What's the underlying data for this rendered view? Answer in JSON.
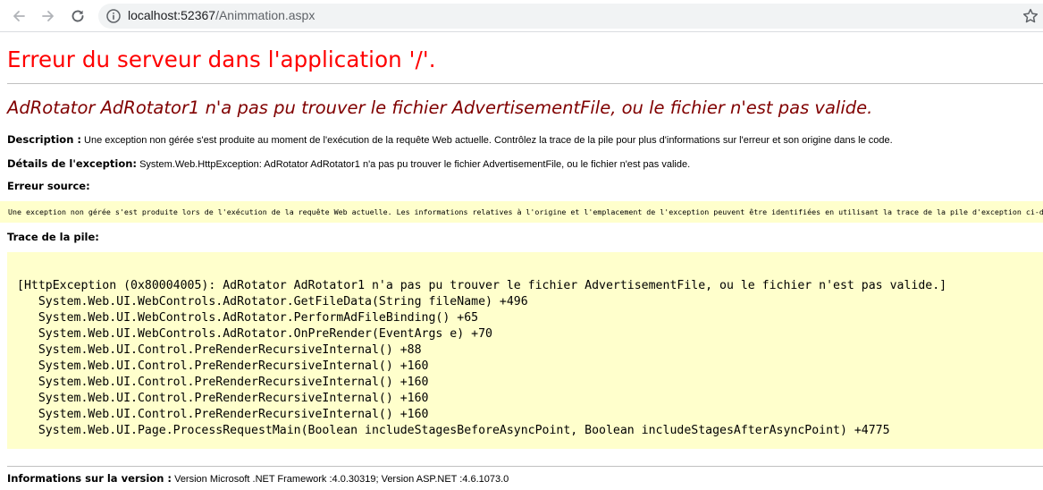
{
  "browser": {
    "url_host": "localhost:52367",
    "url_path": "/Animmation.aspx"
  },
  "page": {
    "title": "Erreur du serveur dans l'application '/'.",
    "error_heading": "AdRotator AdRotator1 n'a pas pu trouver le fichier AdvertisementFile, ou le fichier n'est pas valide.",
    "description_label": "Description :",
    "description_text": " Une exception non gérée s'est produite au moment de l'exécution de la requête Web actuelle. Contrôlez la trace de la pile pour plus d'informations sur l'erreur et son origine dans le code.",
    "exception_label": "Détails de l'exception:",
    "exception_text": " System.Web.HttpException: AdRotator AdRotator1 n'a pas pu trouver le fichier AdvertisementFile, ou le fichier n'est pas valide.",
    "source_label": "Erreur source:",
    "source_text": "Une exception non gérée s'est produite lors de l'exécution de la requête Web actuelle. Les informations relatives à l'origine et l'emplacement de l'exception peuvent être identifiées en utilisant la trace de la pile d'exception ci-dessous.",
    "stack_label": "Trace de la pile:",
    "stack_lines": [
      "[HttpException (0x80004005): AdRotator AdRotator1 n'a pas pu trouver le fichier AdvertisementFile, ou le fichier n'est pas valide.]",
      "   System.Web.UI.WebControls.AdRotator.GetFileData(String fileName) +496",
      "   System.Web.UI.WebControls.AdRotator.PerformAdFileBinding() +65",
      "   System.Web.UI.WebControls.AdRotator.OnPreRender(EventArgs e) +70",
      "   System.Web.UI.Control.PreRenderRecursiveInternal() +88",
      "   System.Web.UI.Control.PreRenderRecursiveInternal() +160",
      "   System.Web.UI.Control.PreRenderRecursiveInternal() +160",
      "   System.Web.UI.Control.PreRenderRecursiveInternal() +160",
      "   System.Web.UI.Control.PreRenderRecursiveInternal() +160",
      "   System.Web.UI.Page.ProcessRequestMain(Boolean includeStagesBeforeAsyncPoint, Boolean includeStagesAfterAsyncPoint) +4775"
    ],
    "version_label": "Informations sur la version :",
    "version_text": " Version Microsoft .NET Framework :4.0.30319; Version ASP.NET :4.6.1073.0"
  },
  "icons": {
    "back": "arrow-left-icon",
    "forward": "arrow-right-icon",
    "reload": "reload-icon",
    "info": "info-icon",
    "bookmark": "star-icon"
  },
  "colors": {
    "title": "#ff0000",
    "heading": "#800000",
    "code_background": "#ffffcc"
  }
}
